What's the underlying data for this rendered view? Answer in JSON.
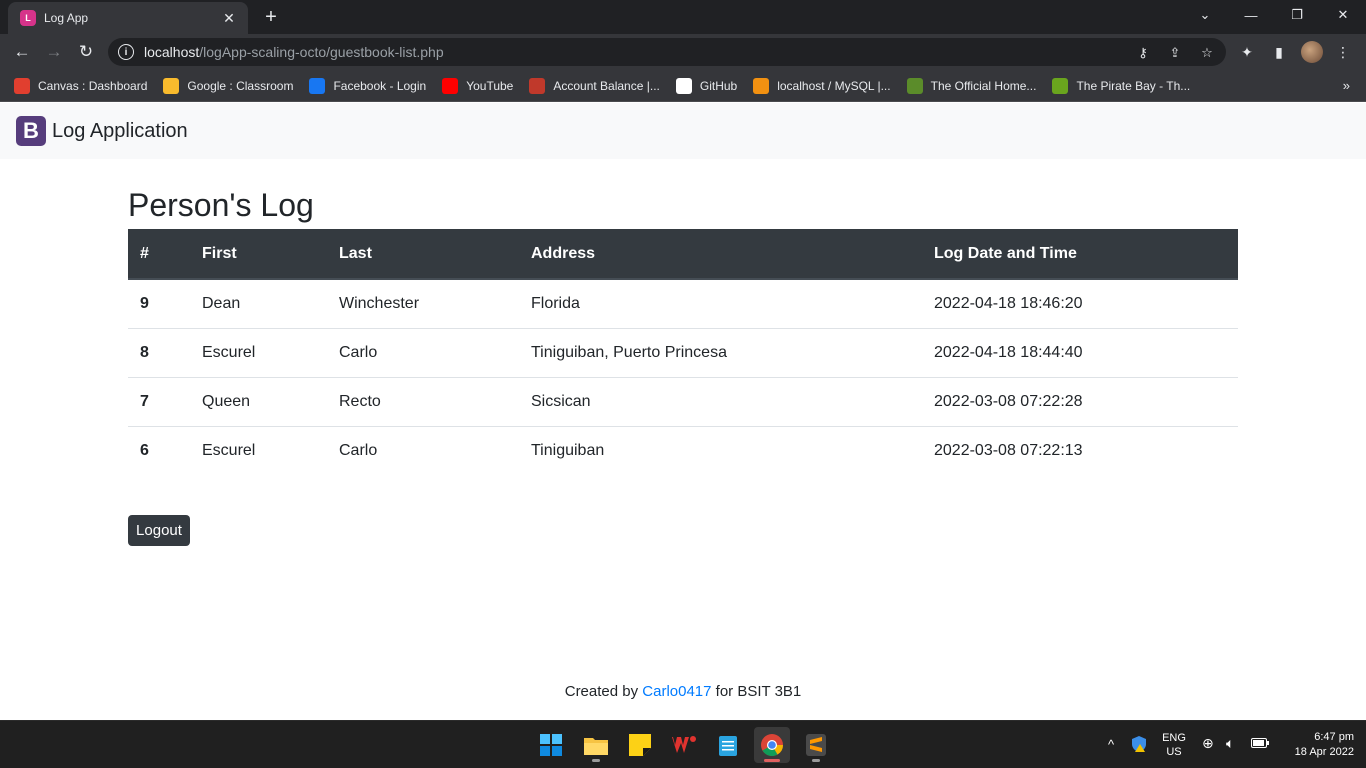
{
  "browser": {
    "tab_title": "Log App",
    "url_host": "localhost",
    "url_path": "/logApp-scaling-octo/guestbook-list.php",
    "bookmarks": [
      {
        "label": "Canvas : Dashboard",
        "icon": "canvas-icon",
        "color": "#e13f2f"
      },
      {
        "label": "Google : Classroom",
        "icon": "classroom-icon",
        "color": "#f9bb2d"
      },
      {
        "label": "Facebook - Login",
        "icon": "facebook-icon",
        "color": "#1877f2"
      },
      {
        "label": "YouTube",
        "icon": "youtube-icon",
        "color": "#ff0000"
      },
      {
        "label": "Account Balance |...",
        "icon": "account-icon",
        "color": "#c0392b"
      },
      {
        "label": "GitHub",
        "icon": "github-icon",
        "color": "#ffffff"
      },
      {
        "label": "localhost / MySQL |...",
        "icon": "phpmyadmin-icon",
        "color": "#f29111"
      },
      {
        "label": "The Official Home...",
        "icon": "home-icon",
        "color": "#5b8c2a"
      },
      {
        "label": "The Pirate Bay - Th...",
        "icon": "piratebay-icon",
        "color": "#6aa51e"
      }
    ]
  },
  "app": {
    "brand_letter": "B",
    "brand_title": "Log Application",
    "heading": "Person's Log",
    "columns": [
      "#",
      "First",
      "Last",
      "Address",
      "Log Date and Time"
    ],
    "rows": [
      {
        "num": "9",
        "first": "Dean",
        "last": "Winchester",
        "address": "Florida",
        "datetime": "2022-04-18 18:46:20"
      },
      {
        "num": "8",
        "first": "Escurel",
        "last": "Carlo",
        "address": "Tiniguiban, Puerto Princesa",
        "datetime": "2022-04-18 18:44:40"
      },
      {
        "num": "7",
        "first": "Queen",
        "last": "Recto",
        "address": "Sicsican",
        "datetime": "2022-03-08 07:22:28"
      },
      {
        "num": "6",
        "first": "Escurel",
        "last": "Carlo",
        "address": "Tiniguiban",
        "datetime": "2022-03-08 07:22:13"
      }
    ],
    "logout_label": "Logout",
    "footer": {
      "prefix": "Created by ",
      "link": "Carlo0417",
      "suffix": " for BSIT 3B1"
    }
  },
  "taskbar": {
    "lang": "ENG",
    "region": "US",
    "time": "6:47 pm",
    "date": "18 Apr 2022"
  },
  "colors": {
    "dark": "#343a40",
    "link": "#007bff",
    "brand": "#563d7c"
  }
}
